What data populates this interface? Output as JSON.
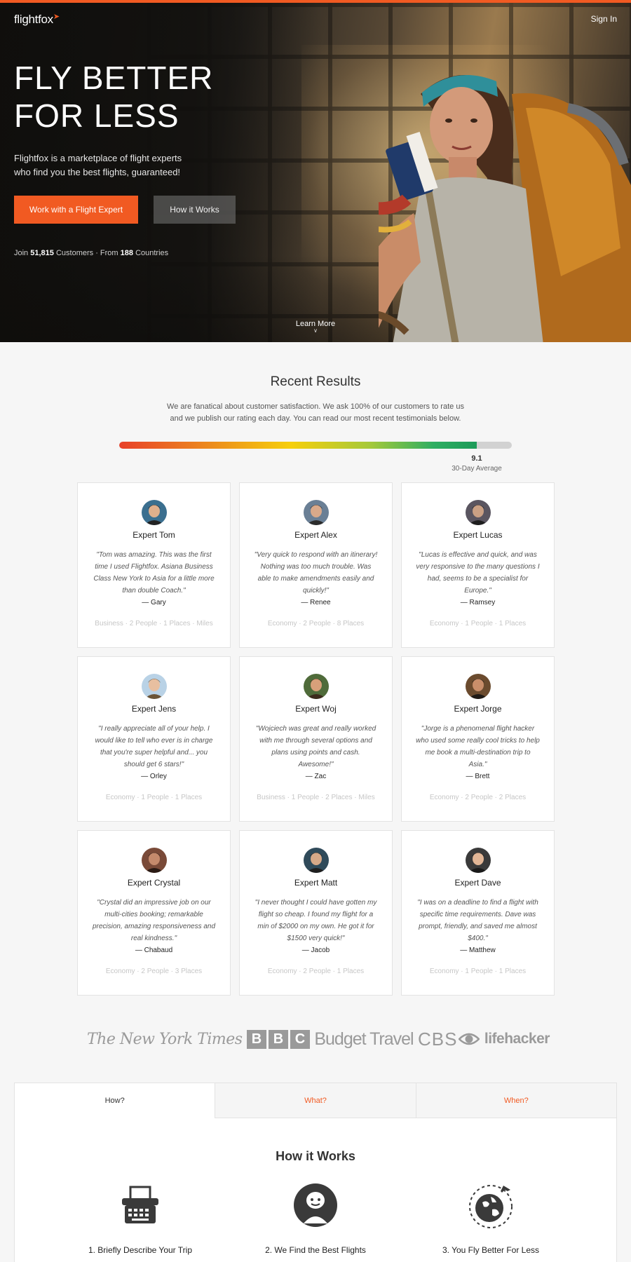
{
  "header": {
    "logo": "flightfox",
    "signin": "Sign In"
  },
  "hero": {
    "title_line1": "FLY BETTER",
    "title_line2": "FOR LESS",
    "subtitle": "Flightfox is a marketplace of flight experts who find you the best flights, guaranteed!",
    "primary_button": "Work with a Flight Expert",
    "secondary_button": "How it Works",
    "stats_prefix": "Join",
    "stats_customers": "51,815",
    "stats_mid": "Customers · From",
    "stats_countries": "188",
    "stats_suffix": "Countries",
    "learn_more": "Learn More"
  },
  "results": {
    "title": "Recent Results",
    "description": "We are fanatical about customer satisfaction. We ask 100% of our customers to rate us and we publish our rating each day. You can read our most recent testimonials below.",
    "rating_value": "9.1",
    "rating_fraction": 0.91,
    "rating_caption": "30-Day Average",
    "cards": [
      {
        "expert": "Expert Tom",
        "quote": "\"Tom was amazing. This was the first time I used Flightfox. Asiana Business Class New York to Asia for a little more than double Coach.\"",
        "author": "— Gary",
        "meta": "Business · 2 People · 1 Places · Miles"
      },
      {
        "expert": "Expert Alex",
        "quote": "\"Very quick to respond with an itinerary! Nothing was too much trouble. Was able to make amendments easily and quickly!\"",
        "author": "— Renee",
        "meta": "Economy · 2 People · 8 Places"
      },
      {
        "expert": "Expert Lucas",
        "quote": "\"Lucas is effective and quick, and was very responsive to the many questions I had, seems to be a specialist for Europe.\"",
        "author": "— Ramsey",
        "meta": "Economy · 1 People · 1 Places"
      },
      {
        "expert": "Expert Jens",
        "quote": "\"I really appreciate all of your help. I would like to tell who ever is in charge that you're super helpful and... you should get 6 stars!\"",
        "author": "— Orley",
        "meta": "Economy · 1 People · 1 Places"
      },
      {
        "expert": "Expert Woj",
        "quote": "\"Wojciech was great and really worked with me through several options and plans using points and cash. Awesome!\"",
        "author": "— Zac",
        "meta": "Business · 1 People · 2 Places · Miles"
      },
      {
        "expert": "Expert Jorge",
        "quote": "\"Jorge is a phenomenal flight hacker who used some really cool tricks to help me book a multi-destination trip to Asia.\"",
        "author": "— Brett",
        "meta": "Economy · 2 People · 2 Places"
      },
      {
        "expert": "Expert Crystal",
        "quote": "\"Crystal did an impressive job on our multi-cities booking; remarkable precision, amazing responsiveness and real kindness.\"",
        "author": "— Chabaud",
        "meta": "Economy · 2 People · 3 Places"
      },
      {
        "expert": "Expert Matt",
        "quote": "\"I never thought I could have gotten my flight so cheap. I found my flight for a min of $2000 on my own. He got it for $1500 very quick!\"",
        "author": "— Jacob",
        "meta": "Economy · 2 People · 1 Places"
      },
      {
        "expert": "Expert Dave",
        "quote": "\"I was on a deadline to find a flight with specific time requirements. Dave was prompt, friendly, and saved me almost $400.\"",
        "author": "— Matthew",
        "meta": "Economy · 1 People · 1 Places"
      }
    ]
  },
  "press": {
    "nyt": "The New York Times",
    "bbc": [
      "B",
      "B",
      "C"
    ],
    "budget_travel": "Budget Travel",
    "cbs": "CBS",
    "lifehacker": "lifehacker"
  },
  "tabs": [
    "How?",
    "What?",
    "When?"
  ],
  "how_it_works": {
    "title": "How it Works",
    "steps": [
      {
        "label": "1. Briefly Describe Your Trip",
        "icon": "typewriter-icon"
      },
      {
        "label": "2. We Find the Best Flights",
        "icon": "expert-face-icon"
      },
      {
        "label": "3. You Fly Better For Less",
        "icon": "globe-plane-icon"
      }
    ]
  },
  "colors": {
    "accent": "#f15a22",
    "rating_track": "#d2d2d2"
  }
}
